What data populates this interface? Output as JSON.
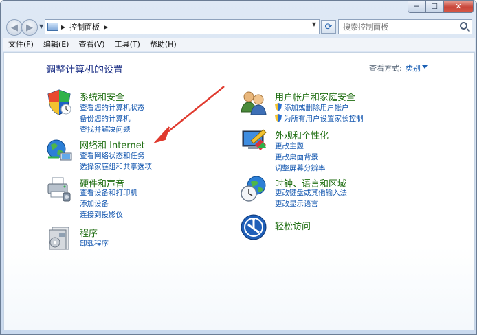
{
  "window": {
    "close_label": "✕",
    "min_label": "─",
    "max_label": "☐"
  },
  "nav": {
    "address_path": "控制面板",
    "search_placeholder": "搜索控制面板"
  },
  "menu": [
    "文件(F)",
    "编辑(E)",
    "查看(V)",
    "工具(T)",
    "帮助(H)"
  ],
  "page": {
    "title": "调整计算机的设置",
    "view_by_label": "查看方式:",
    "view_by_value": "类别"
  },
  "left_categories": [
    {
      "title": "系统和安全",
      "links": [
        "查看您的计算机状态",
        "备份您的计算机",
        "查找并解决问题"
      ]
    },
    {
      "title": "网络和 Internet",
      "links": [
        "查看网络状态和任务",
        "选择家庭组和共享选项"
      ]
    },
    {
      "title": "硬件和声音",
      "links": [
        "查看设备和打印机",
        "添加设备",
        "连接到投影仪"
      ]
    },
    {
      "title": "程序",
      "links": [
        "卸载程序"
      ]
    }
  ],
  "right_categories": [
    {
      "title": "用户帐户和家庭安全",
      "links": [
        "添加或删除用户帐户",
        "为所有用户设置家长控制"
      ]
    },
    {
      "title": "外观和个性化",
      "links": [
        "更改主题",
        "更改桌面背景",
        "调整屏幕分辨率"
      ]
    },
    {
      "title": "时钟、语言和区域",
      "links": [
        "更改键盘或其他输入法",
        "更改显示语言"
      ]
    },
    {
      "title": "轻松访问",
      "links": []
    }
  ],
  "colors": {
    "category_title": "#1f6e12",
    "link": "#1558b0",
    "page_title": "#1e3287",
    "annotation_arrow": "#e03a2e"
  }
}
